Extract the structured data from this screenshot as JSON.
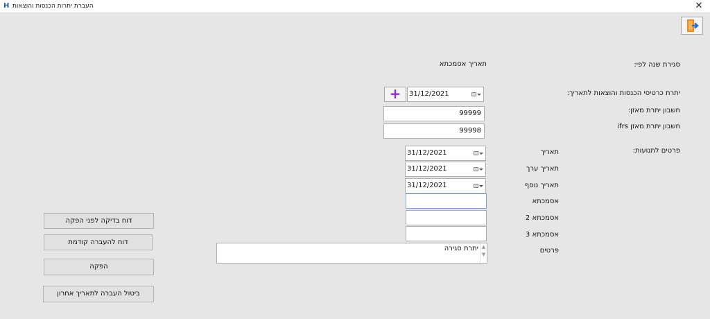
{
  "window": {
    "title": "העברת יתרות הכנסות והוצאות"
  },
  "labels": {
    "close_year_by": "סגירת שנה לפי:",
    "date_reference": "תאריך אסמכתא",
    "balance_date": "יתרת כרטיסי הכנסות והוצאות לתאריך:",
    "account_balance": "חשבון יתרת מאזן:",
    "account_balance_ifrs": "חשבון יתרת מאזן ifrs",
    "posting_details": "פרטים לתנועות:",
    "date": "תאריך",
    "value_date": "תאריך ערך",
    "extra_date": "תאריך נוסף",
    "reference": "אסמכתא",
    "reference2": "אסמכתא 2",
    "reference3": "אסמכתא 3",
    "details": "פרטים"
  },
  "fields": {
    "balance_date": "31/12/2021",
    "account_balance": "99999",
    "account_balance_ifrs": "99998",
    "date": "31/12/2021",
    "value_date": "31/12/2021",
    "extra_date": "31/12/2021",
    "reference": "",
    "reference2": "",
    "reference3": "",
    "details": "יתרת סגירה"
  },
  "buttons": {
    "check_report": "דוח בדיקה לפני הפקה",
    "previous_report": "דוח להעברה קודמת",
    "produce": "הפקה",
    "cancel_last": "ביטול העברה לתאריך אחרון"
  },
  "icons": {
    "app": "app-logo-icon",
    "exit": "exit-door-icon",
    "plus": "plus-icon",
    "calendar": "calendar-icon"
  },
  "colors": {
    "accent": "#8a2be2",
    "exit_door": "#f08a1c",
    "exit_arrow": "#2a6fd6"
  }
}
